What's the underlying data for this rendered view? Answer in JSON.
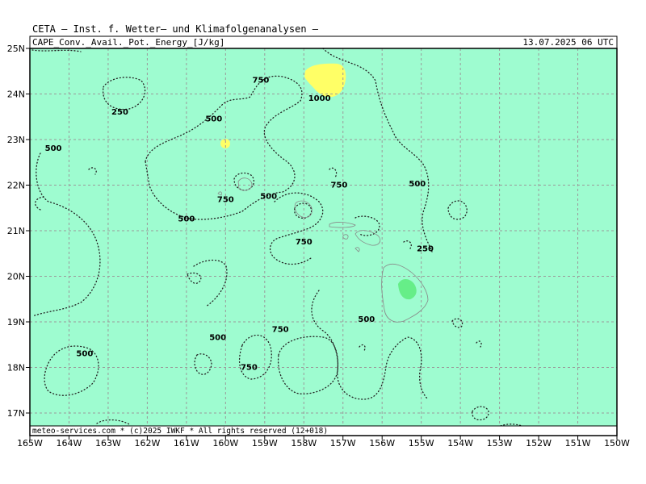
{
  "header": {
    "title": "CETA — Inst. f. Wetter— und Klimafolgenanalysen —",
    "parameter": "CAPE_Conv._Avail._Pot._Energy_[J/kg]",
    "datetime": "13.07.2025 06 UTC"
  },
  "footer": {
    "credit": "meteo-services.com * (c)2025 IWKF * All rights reserved (12+018)"
  },
  "colors": {
    "background": "#9efcd0",
    "band_1000": "#ffff66",
    "band_low": "#66ee88",
    "contour_line": "#222222",
    "grid_line": "#9a9a9a"
  },
  "map": {
    "region": "Hawaiian Islands",
    "lon_range": [
      -165,
      -150
    ],
    "lat_range": [
      16.5,
      25
    ],
    "x_ticks": [
      "165W",
      "164W",
      "163W",
      "162W",
      "161W",
      "160W",
      "159W",
      "158W",
      "157W",
      "156W",
      "155W",
      "154W",
      "153W",
      "152W",
      "151W",
      "150W"
    ],
    "y_ticks": [
      "25N",
      "24N",
      "23N",
      "22N",
      "21N",
      "20N",
      "19N",
      "18N",
      "17N"
    ],
    "contour_labels": [
      {
        "text": "750",
        "lon": -159.1,
        "lat": 24.25
      },
      {
        "text": "1000",
        "lon": -157.6,
        "lat": 23.85
      },
      {
        "text": "250",
        "lon": -162.7,
        "lat": 23.55
      },
      {
        "text": "500",
        "lon": -160.3,
        "lat": 23.4
      },
      {
        "text": "500",
        "lon": -164.4,
        "lat": 22.75
      },
      {
        "text": "750",
        "lon": -157.1,
        "lat": 21.95
      },
      {
        "text": "500",
        "lon": -155.1,
        "lat": 21.97
      },
      {
        "text": "750",
        "lon": -160.0,
        "lat": 21.63
      },
      {
        "text": "500",
        "lon": -158.9,
        "lat": 21.7
      },
      {
        "text": "500",
        "lon": -161.0,
        "lat": 21.2
      },
      {
        "text": "750",
        "lon": -158.0,
        "lat": 20.7
      },
      {
        "text": "250",
        "lon": -154.9,
        "lat": 20.55
      },
      {
        "text": "500",
        "lon": -156.4,
        "lat": 19.0
      },
      {
        "text": "750",
        "lon": -158.6,
        "lat": 18.78
      },
      {
        "text": "500",
        "lon": -160.2,
        "lat": 18.6
      },
      {
        "text": "500",
        "lon": -163.6,
        "lat": 18.25
      },
      {
        "text": "750",
        "lon": -159.4,
        "lat": 17.95
      }
    ],
    "legend": "none",
    "grid": true
  }
}
